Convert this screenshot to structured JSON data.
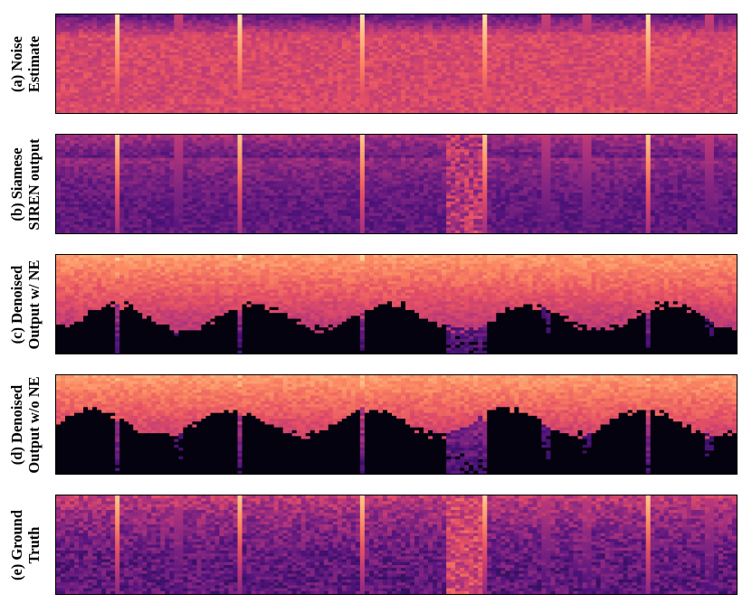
{
  "chart_data": {
    "type": "heatmap",
    "colormap": "magma",
    "axes_visible": false,
    "panels": [
      {
        "label_lines": [
          "(a) Noise",
          "Estimate"
        ],
        "kind": "noise"
      },
      {
        "label_lines": [
          "(b) Siamese",
          "SIREN output"
        ],
        "kind": "siren"
      },
      {
        "label_lines": [
          "(c) Denoised",
          "Output w/ NE"
        ],
        "kind": "denoised_ne"
      },
      {
        "label_lines": [
          "(d) Denoised",
          "Output w/o NE"
        ],
        "kind": "denoised_none"
      },
      {
        "label_lines": [
          "(e) Ground",
          "Truth"
        ],
        "kind": "ground_truth"
      }
    ],
    "onsets": [
      0.09,
      0.18,
      0.27,
      0.45,
      0.63,
      0.72,
      0.78,
      0.87,
      0.96
    ]
  }
}
